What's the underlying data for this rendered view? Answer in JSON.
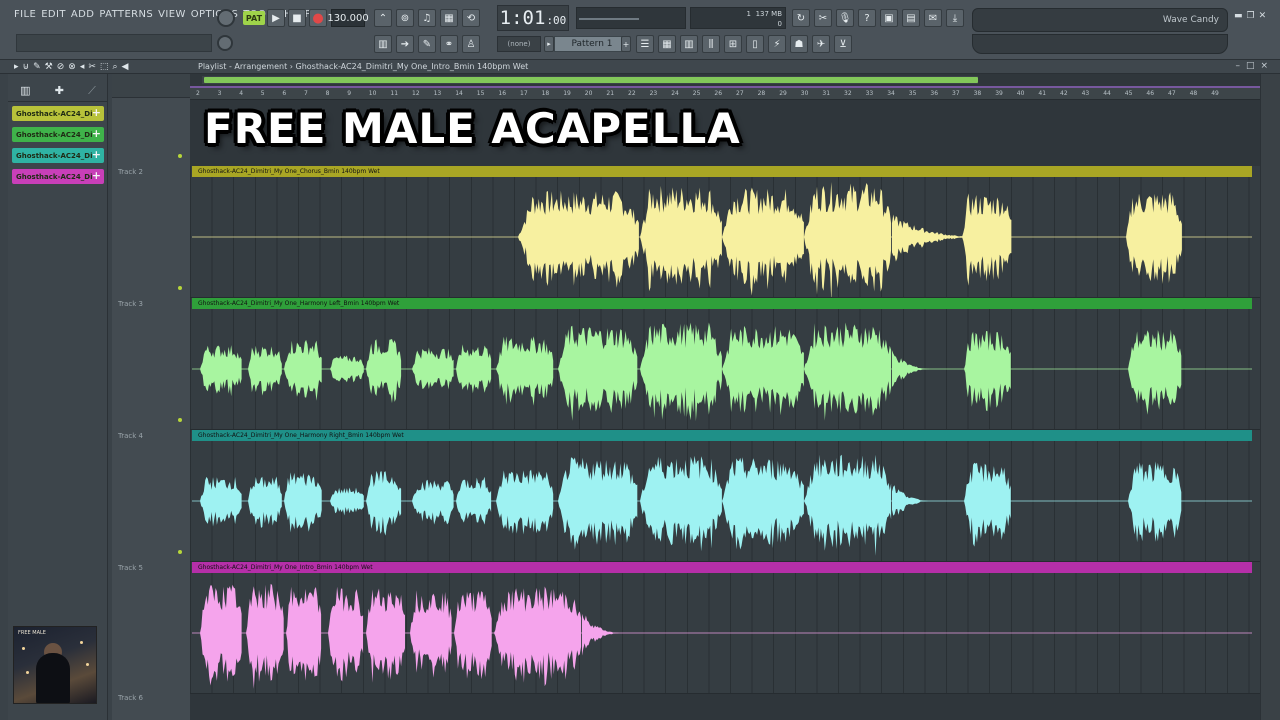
{
  "menu": [
    "FILE",
    "EDIT",
    "ADD",
    "PATTERNS",
    "VIEW",
    "OPTIONS",
    "TOOLS",
    "HELP"
  ],
  "transport": {
    "pat_label": "PAT",
    "tempo": "130.000",
    "time_main": "1:01",
    "time_sub": ":00",
    "mem_top": "1",
    "mem_right": "137 MB",
    "mem_bottom": "0"
  },
  "pattern_selector": "Pattern 1",
  "none_selector": "(none)",
  "browser_title": "Wave Candy",
  "playlist": {
    "title": "Playlist - Arrangement › Ghosthack-AC24_Dimitri_My One_Intro_Bmin 140bpm Wet"
  },
  "clip_picker": [
    {
      "label": "Ghosthack-AC24_Di",
      "color": "#b8c23a"
    },
    {
      "label": "Ghosthack-AC24_Di",
      "color": "#3fb34a"
    },
    {
      "label": "Ghosthack-AC24_Di",
      "color": "#2fb3a3"
    },
    {
      "label": "Ghosthack-AC24_Di",
      "color": "#c83fb8"
    }
  ],
  "thumbnail_label": "FREE MALE",
  "tracks": [
    {
      "name": "Track 2",
      "clip": "Ghosthack-AC24_Dimitri_My One_Chorus_Bmin 140bpm Wet",
      "head_color": "#a9a624",
      "wave_color": "#f7f0a0"
    },
    {
      "name": "Track 3",
      "clip": "Ghosthack-AC24_Dimitri_My One_Harmony Left_Bmin 140bpm Wet",
      "head_color": "#2fa03a",
      "wave_color": "#a8f5a0"
    },
    {
      "name": "Track 4",
      "clip": "Ghosthack-AC24_Dimitri_My One_Harmony Right_Bmin 140bpm Wet",
      "head_color": "#1f9088",
      "wave_color": "#9ef2f2"
    },
    {
      "name": "Track 5",
      "clip": "Ghosthack-AC24_Dimitri_My One_Intro_Bmin 140bpm Wet",
      "head_color": "#b52fa8",
      "wave_color": "#f5a4ec"
    }
  ],
  "track_6": "Track 6",
  "ruler_numbers": [
    "2",
    "3",
    "4",
    "5",
    "6",
    "7",
    "8",
    "9",
    "10",
    "11",
    "12",
    "13",
    "14",
    "15",
    "16",
    "17",
    "18",
    "19",
    "20",
    "21",
    "22",
    "23",
    "24",
    "25",
    "26",
    "27",
    "28",
    "29",
    "30",
    "31",
    "32",
    "33",
    "34",
    "35",
    "36",
    "37",
    "38",
    "39",
    "40",
    "41",
    "42",
    "43",
    "44",
    "45",
    "46",
    "47",
    "48",
    "49"
  ],
  "overlay_title": "FREE MALE ACAPELLA"
}
